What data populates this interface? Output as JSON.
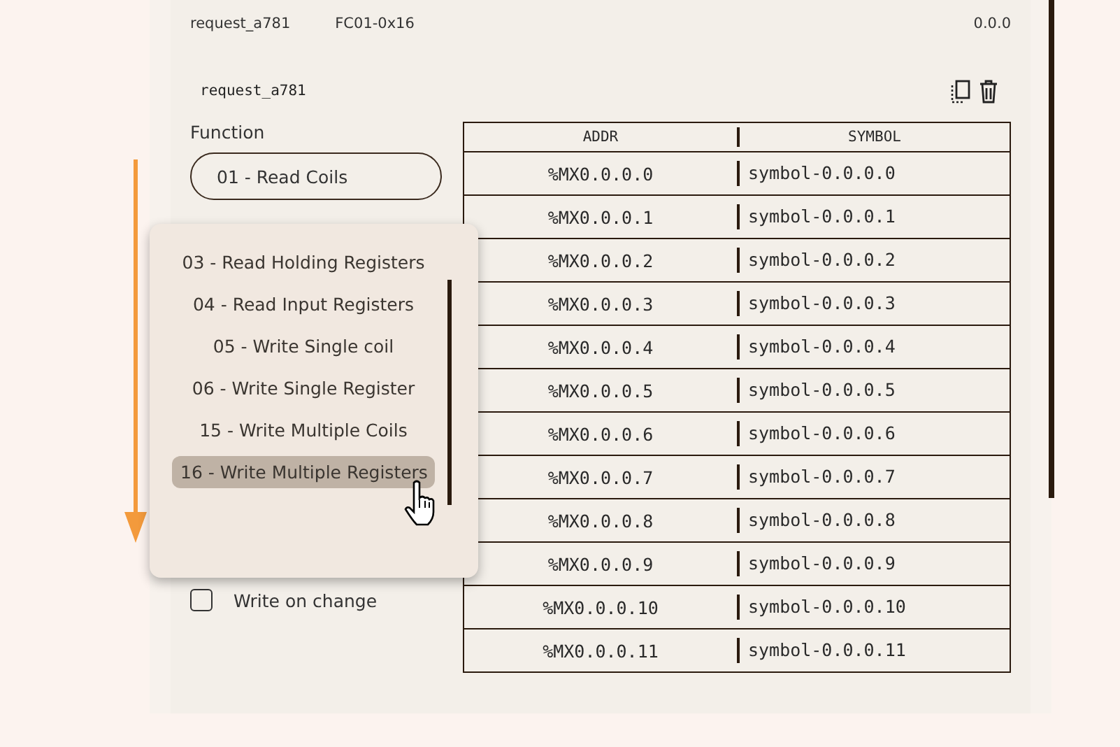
{
  "header": {
    "name": "request_a781",
    "code": "FC01-0x16",
    "version": "0.0.0"
  },
  "request": {
    "name": "request_a781"
  },
  "function": {
    "label": "Function",
    "value": "01 - Read Coils"
  },
  "dropdown": {
    "options": [
      {
        "label": "03 - Read Holding Registers",
        "selected": false
      },
      {
        "label": "04 - Read Input Registers",
        "selected": false
      },
      {
        "label": "05 - Write Single coil",
        "selected": false
      },
      {
        "label": "06 - Write Single Register",
        "selected": false
      },
      {
        "label": "15 - Write Multiple Coils",
        "selected": false
      },
      {
        "label": "16 - Write Multiple Registers",
        "selected": true
      }
    ]
  },
  "write_on_change": {
    "label": "Write on change",
    "checked": false
  },
  "table": {
    "columns": [
      "ADDR",
      "SYMBOL"
    ],
    "rows": [
      [
        "%MX0.0.0.0",
        "symbol-0.0.0.0"
      ],
      [
        "%MX0.0.0.1",
        "symbol-0.0.0.1"
      ],
      [
        "%MX0.0.0.2",
        "symbol-0.0.0.2"
      ],
      [
        "%MX0.0.0.3",
        "symbol-0.0.0.3"
      ],
      [
        "%MX0.0.0.4",
        "symbol-0.0.0.4"
      ],
      [
        "%MX0.0.0.5",
        "symbol-0.0.0.5"
      ],
      [
        "%MX0.0.0.6",
        "symbol-0.0.0.6"
      ],
      [
        "%MX0.0.0.7",
        "symbol-0.0.0.7"
      ],
      [
        "%MX0.0.0.8",
        "symbol-0.0.0.8"
      ],
      [
        "%MX0.0.0.9",
        "symbol-0.0.0.9"
      ],
      [
        "%MX0.0.0.10",
        "symbol-0.0.0.10"
      ],
      [
        "%MX0.0.0.11",
        "symbol-0.0.0.11"
      ]
    ]
  }
}
